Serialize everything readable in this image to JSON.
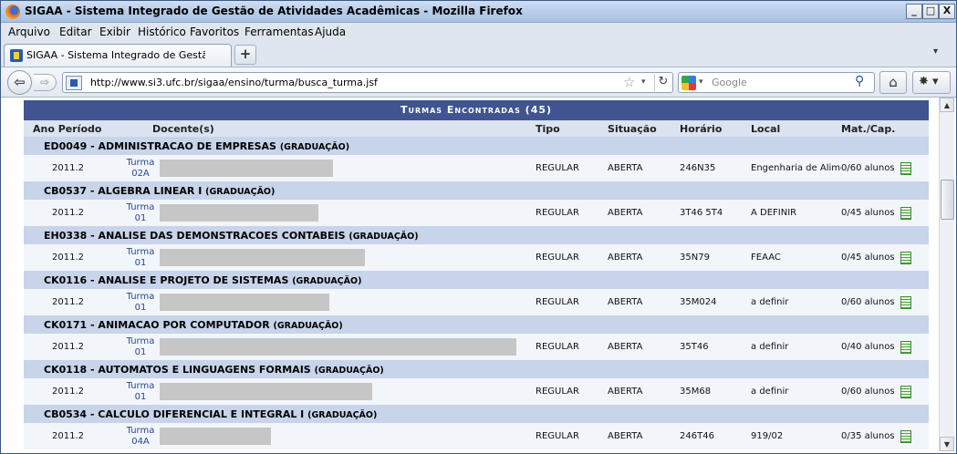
{
  "window": {
    "title": "SIGAA - Sistema Integrado de Gestão de Atividades Acadêmicas - Mozilla Firefox",
    "minimize": "_",
    "maximize": "□",
    "close": "X"
  },
  "menu": [
    "Arquivo",
    "Editar",
    "Exibir",
    "Histórico",
    "Favoritos",
    "Ferramentas",
    "Ajuda"
  ],
  "tab": {
    "title": "SIGAA - Sistema Integrado de Gestão de Ati...",
    "new_tab": "+"
  },
  "nav": {
    "url": "http://www.si3.ufc.br/sigaa/ensino/turma/busca_turma.jsf",
    "search_placeholder": "Google"
  },
  "table": {
    "caption": "Turmas Encontradas (45)",
    "headers": [
      "Ano Período",
      "Docente(s)",
      "Tipo",
      "Situação",
      "Horário",
      "Local",
      "Mat./Cap."
    ],
    "groups": [
      {
        "course": "ED0049 - ADMINISTRACAO DE EMPRESAS",
        "level": "(GRADUAÇÃO)",
        "row": {
          "period": "2011.2",
          "turma": "Turma",
          "code": "02A",
          "docente_bar": 0.48,
          "tipo": "REGULAR",
          "situacao": "ABERTA",
          "horario": "246N35",
          "local": "Engenharia de Alimentos",
          "mat": "0/60 alunos"
        }
      },
      {
        "course": "CB0537 - ALGEBRA LINEAR I",
        "level": "(GRADUAÇÃO)",
        "row": {
          "period": "2011.2",
          "turma": "Turma",
          "code": "01",
          "docente_bar": 0.44,
          "tipo": "REGULAR",
          "situacao": "ABERTA",
          "horario": "3T46 5T4",
          "local": "A DEFINIR",
          "mat": "0/45 alunos"
        }
      },
      {
        "course": "EH0338 - ANALISE DAS DEMONSTRACOES CONTABEIS",
        "level": "(GRADUAÇÃO)",
        "row": {
          "period": "2011.2",
          "turma": "Turma",
          "code": "01",
          "docente_bar": 0.57,
          "tipo": "REGULAR",
          "situacao": "ABERTA",
          "horario": "35N79",
          "local": "FEAAC",
          "mat": "0/45 alunos"
        }
      },
      {
        "course": "CK0116 - ANALISE E PROJETO DE SISTEMAS",
        "level": "(GRADUAÇÃO)",
        "row": {
          "period": "2011.2",
          "turma": "Turma",
          "code": "01",
          "docente_bar": 0.47,
          "tipo": "REGULAR",
          "situacao": "ABERTA",
          "horario": "35M024",
          "local": "a definir",
          "mat": "0/60 alunos"
        }
      },
      {
        "course": "CK0171 - ANIMACAO POR COMPUTADOR",
        "level": "(GRADUAÇÃO)",
        "row": {
          "period": "2011.2",
          "turma": "Turma",
          "code": "01",
          "docente_bar": 0.99,
          "tipo": "REGULAR",
          "situacao": "ABERTA",
          "horario": "35T46",
          "local": "a definir",
          "mat": "0/40 alunos"
        }
      },
      {
        "course": "CK0118 - AUTOMATOS E LINGUAGENS FORMAIS",
        "level": "(GRADUAÇÃO)",
        "row": {
          "period": "2011.2",
          "turma": "Turma",
          "code": "01",
          "docente_bar": 0.59,
          "tipo": "REGULAR",
          "situacao": "ABERTA",
          "horario": "35M68",
          "local": "a definir",
          "mat": "0/60 alunos"
        }
      },
      {
        "course": "CB0534 - CALCULO DIFERENCIAL E INTEGRAL I",
        "level": "(GRADUAÇÃO)",
        "row": {
          "period": "2011.2",
          "turma": "Turma",
          "code": "04A",
          "docente_bar": 0.31,
          "tipo": "REGULAR",
          "situacao": "ABERTA",
          "horario": "246T46",
          "local": "919/02",
          "mat": "0/35 alunos"
        }
      }
    ]
  },
  "colors": {
    "caption_bg": "#3f5490",
    "group_bg": "#c7d4ea",
    "row_bg": "#f2f6fb",
    "link": "#2b4690",
    "redacted": "#c6c6c6"
  },
  "icons": {
    "report": "report-icon",
    "home": "home-icon",
    "search": "magnifier-icon"
  }
}
